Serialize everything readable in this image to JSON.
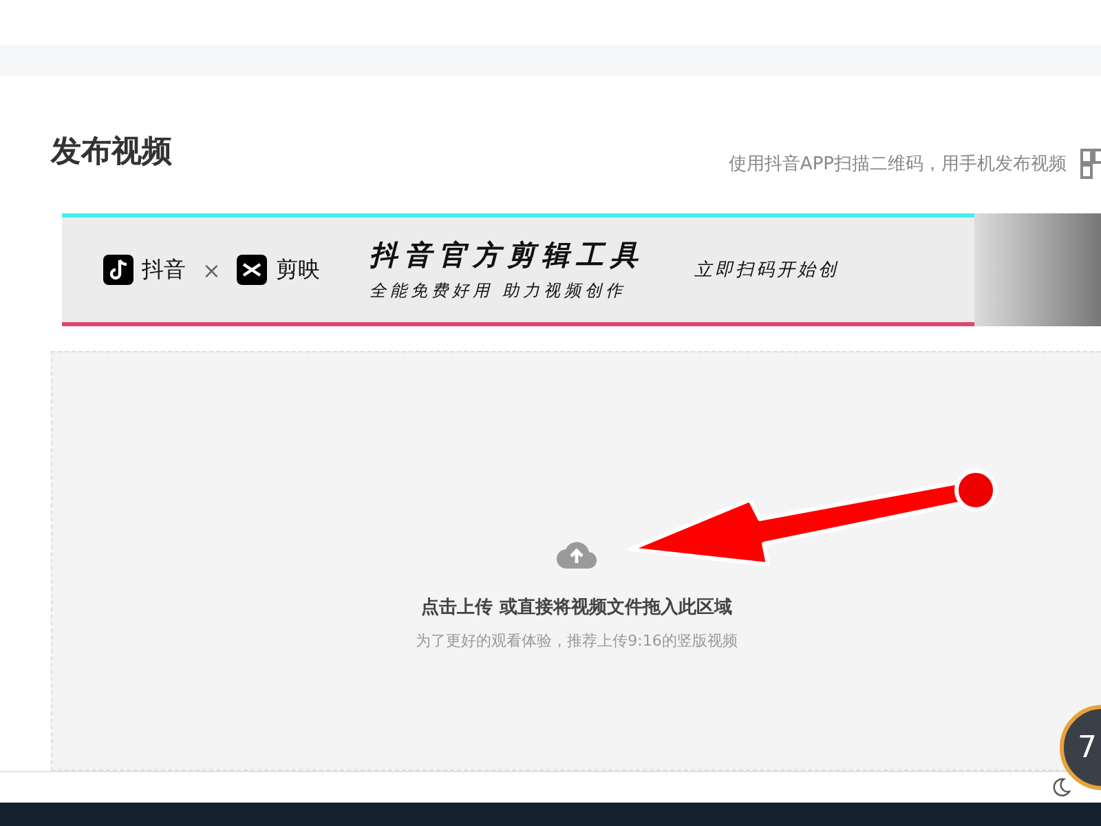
{
  "page": {
    "title": "发布视频",
    "qr_hint": "使用抖音APP扫描二维码，用手机发布视频"
  },
  "banner": {
    "brand_1": "抖音",
    "separator": "×",
    "brand_2": "剪映",
    "headline": "抖音官方剪辑工具",
    "subline": "全能免费好用 助力视频创作",
    "cta": "立即扫码开始创"
  },
  "upload": {
    "prompt": "点击上传 或直接将视频文件拖入此区域",
    "hint": "为了更好的观看体验，推荐上传9:16的竖版视频"
  },
  "floating_widget": {
    "value": "7"
  }
}
